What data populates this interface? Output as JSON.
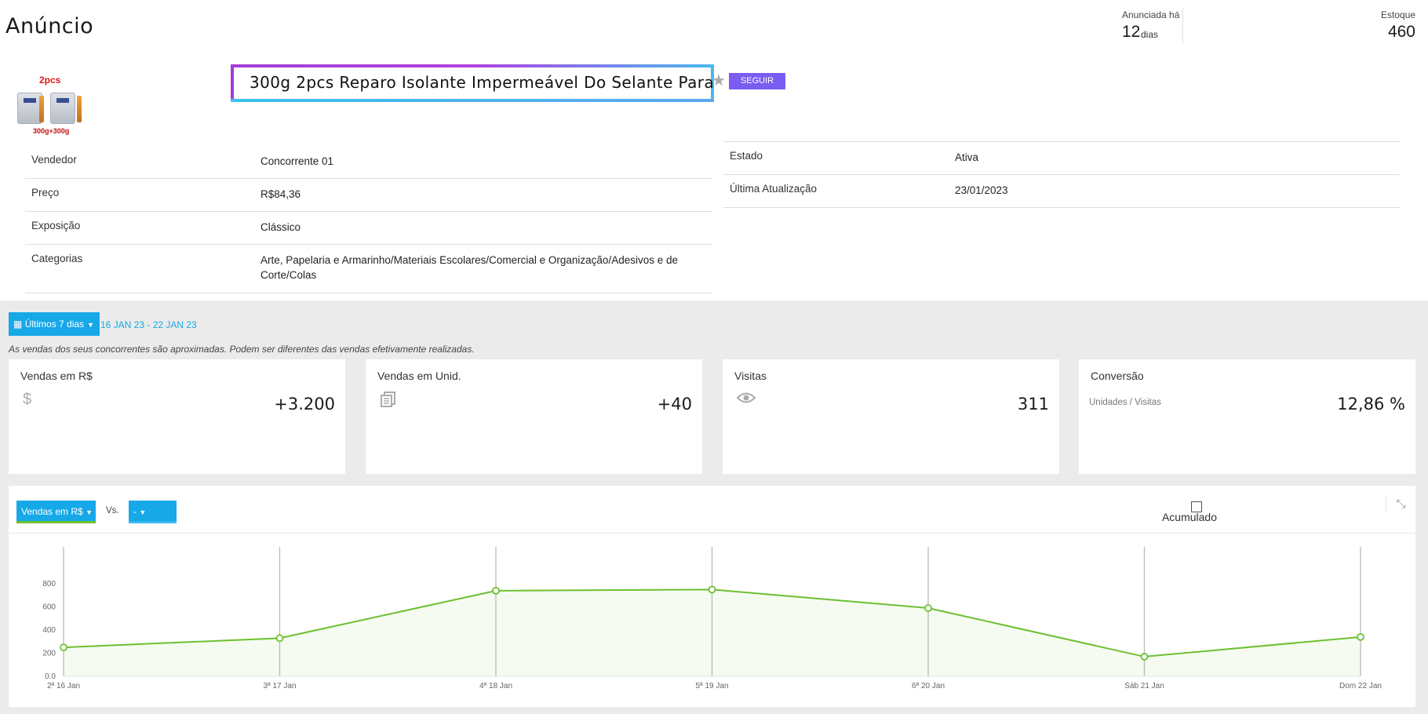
{
  "header": {
    "title": "Anúncio",
    "listed_label": "Anunciada há",
    "listed_value": "12",
    "listed_unit": "dias",
    "stock_label": "Estoque",
    "stock_value": "460"
  },
  "product": {
    "image_tag": "2pcs",
    "image_weight": "300g+300g",
    "title": "300g 2pcs Reparo Isolante Impermeável Do Selante Para",
    "follow_label": "SEGUIR"
  },
  "details_left": [
    {
      "key": "Vendedor",
      "value": "Concorrente 01"
    },
    {
      "key": "Preço",
      "value": "R$84,36"
    },
    {
      "key": "Exposição",
      "value": "Clássico"
    },
    {
      "key": "Categorias",
      "value": "Arte, Papelaria e Armarinho/Materiais Escolares/Comercial e Organização/Adesivos e de Corte/Colas"
    }
  ],
  "details_right": [
    {
      "key": "Estado",
      "value": "Ativa"
    },
    {
      "key": "Última Atualização",
      "value": "23/01/2023"
    }
  ],
  "filters": {
    "period_label": "Últimos 7 dias",
    "period_range": "16 JAN 23 - 22 JAN 23",
    "disclaimer": "As vendas dos seus concorrentes são aproximadas. Podem ser diferentes das vendas efetivamente realizadas."
  },
  "cards": [
    {
      "title": "Vendas em R$",
      "value": "+3.200",
      "icon": "dollar-icon"
    },
    {
      "title": "Vendas em Unid.",
      "value": "+40",
      "icon": "stack-icon"
    },
    {
      "title": "Visitas",
      "value": "311",
      "icon": "eye-icon"
    },
    {
      "title": "Conversão",
      "subtitle": "Unidades / Visitas",
      "value": "12,86 %"
    }
  ],
  "chart_controls": {
    "metric_label": "Vendas em R$",
    "vs_label": "Vs.",
    "compare_label": "-",
    "accumulated_label": "Acumulado"
  },
  "colors": {
    "accent": "#17a8e8",
    "line": "#6cc030",
    "follow": "#7b5cf0"
  },
  "chart_data": {
    "type": "area",
    "categories": [
      "2ª 16 Jan",
      "3ª 17 Jan",
      "4ª 18 Jan",
      "5ª 19 Jan",
      "6ª 20 Jan",
      "Sáb 21 Jan",
      "Dom 22 Jan"
    ],
    "series": [
      {
        "name": "Vendas em R$",
        "values": [
          250,
          330,
          740,
          750,
          590,
          170,
          340
        ]
      }
    ],
    "ylim": [
      0,
      800
    ],
    "yticks": [
      "0.0",
      "200",
      "400",
      "600",
      "800"
    ],
    "grid": "vertical"
  }
}
